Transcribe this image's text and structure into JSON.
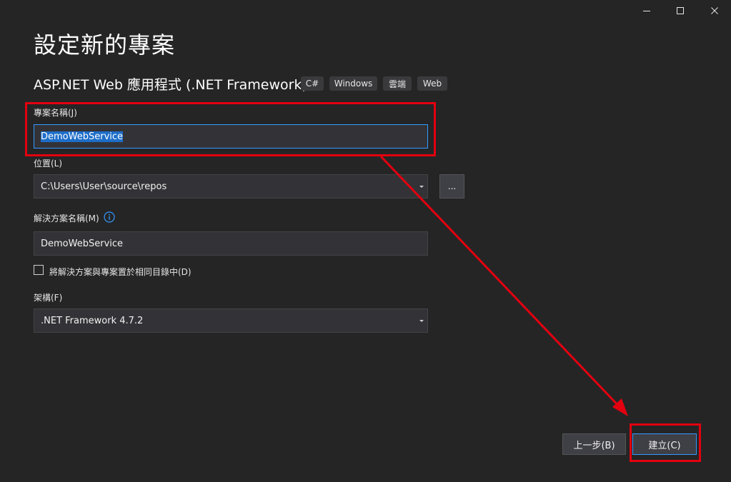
{
  "window": {
    "controls": [
      "minimize",
      "maximize",
      "close"
    ]
  },
  "header": {
    "title": "設定新的專案",
    "template_name": "ASP.NET Web 應用程式 (.NET Framework)",
    "tags": [
      "C#",
      "Windows",
      "雲端",
      "Web"
    ]
  },
  "form": {
    "project_name": {
      "label": "專案名稱(J)",
      "value": "DemoWebService"
    },
    "location": {
      "label": "位置(L)",
      "value": "C:\\Users\\User\\source\\repos",
      "browse_label": "..."
    },
    "solution_name": {
      "label": "解決方案名稱(M)",
      "value": "DemoWebService"
    },
    "same_directory": {
      "label": "將解決方案與專案置於相同目錄中(D)",
      "checked": false
    },
    "framework": {
      "label": "架構(F)",
      "value": ".NET Framework 4.7.2"
    }
  },
  "footer": {
    "back_label": "上一步(B)",
    "create_label": "建立(C)"
  },
  "colors": {
    "background": "#252526",
    "accent": "#3399ff",
    "annotation": "#e3000f"
  }
}
